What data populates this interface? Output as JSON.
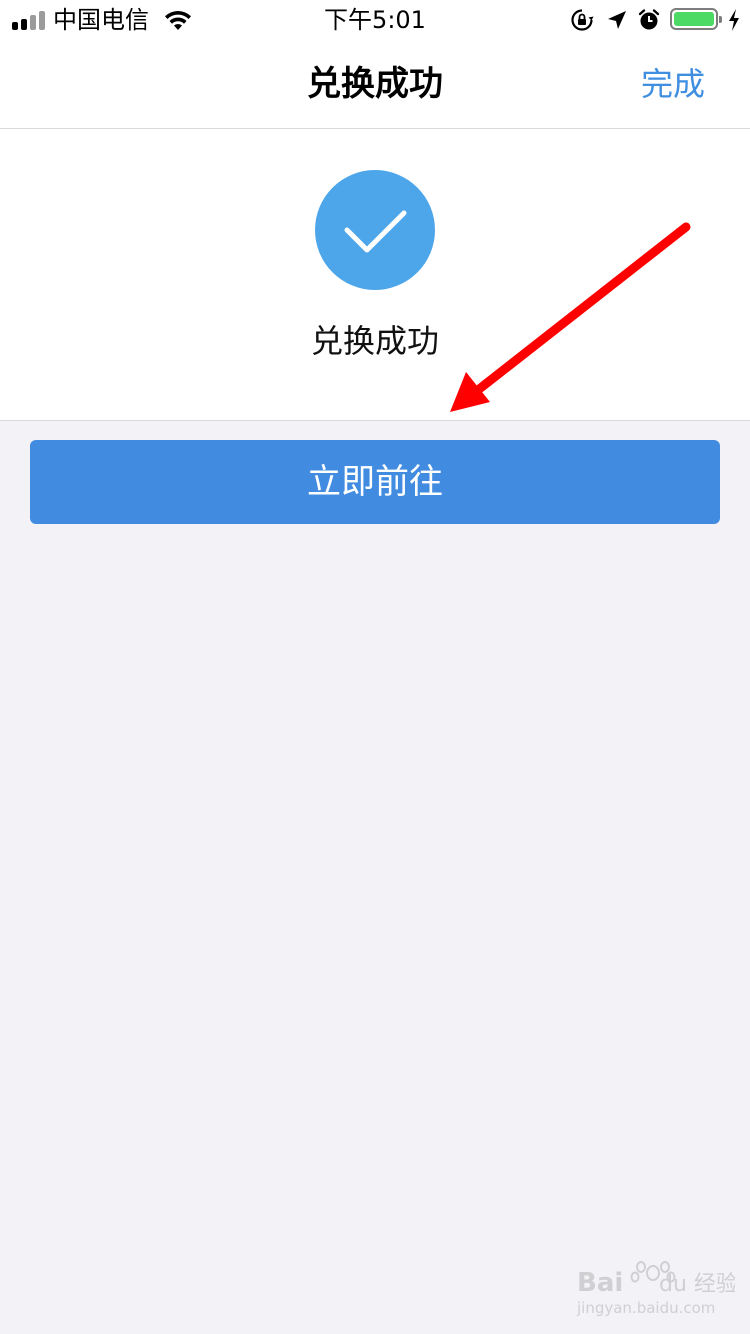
{
  "status_bar": {
    "carrier": "中国电信",
    "time": "下午5:01",
    "battery_level": 1.0,
    "icons": [
      "signal-icon",
      "wifi-icon",
      "orientation-lock-icon",
      "location-arrow-icon",
      "alarm-icon",
      "battery-icon",
      "charging-bolt-icon"
    ]
  },
  "nav": {
    "title": "兑换成功",
    "done_label": "完成"
  },
  "result": {
    "icon": "checkmark-icon",
    "message": "兑换成功"
  },
  "actions": {
    "go_label": "立即前往"
  },
  "colors": {
    "accent": "#3f8ee0",
    "button": "#418ce0",
    "check_circle": "#4ea6ea",
    "annotation_arrow": "#ff0000",
    "background": "#f2f2f7"
  },
  "watermark": {
    "brand": "Bai du 经验",
    "url": "jingyan.baidu.com"
  }
}
